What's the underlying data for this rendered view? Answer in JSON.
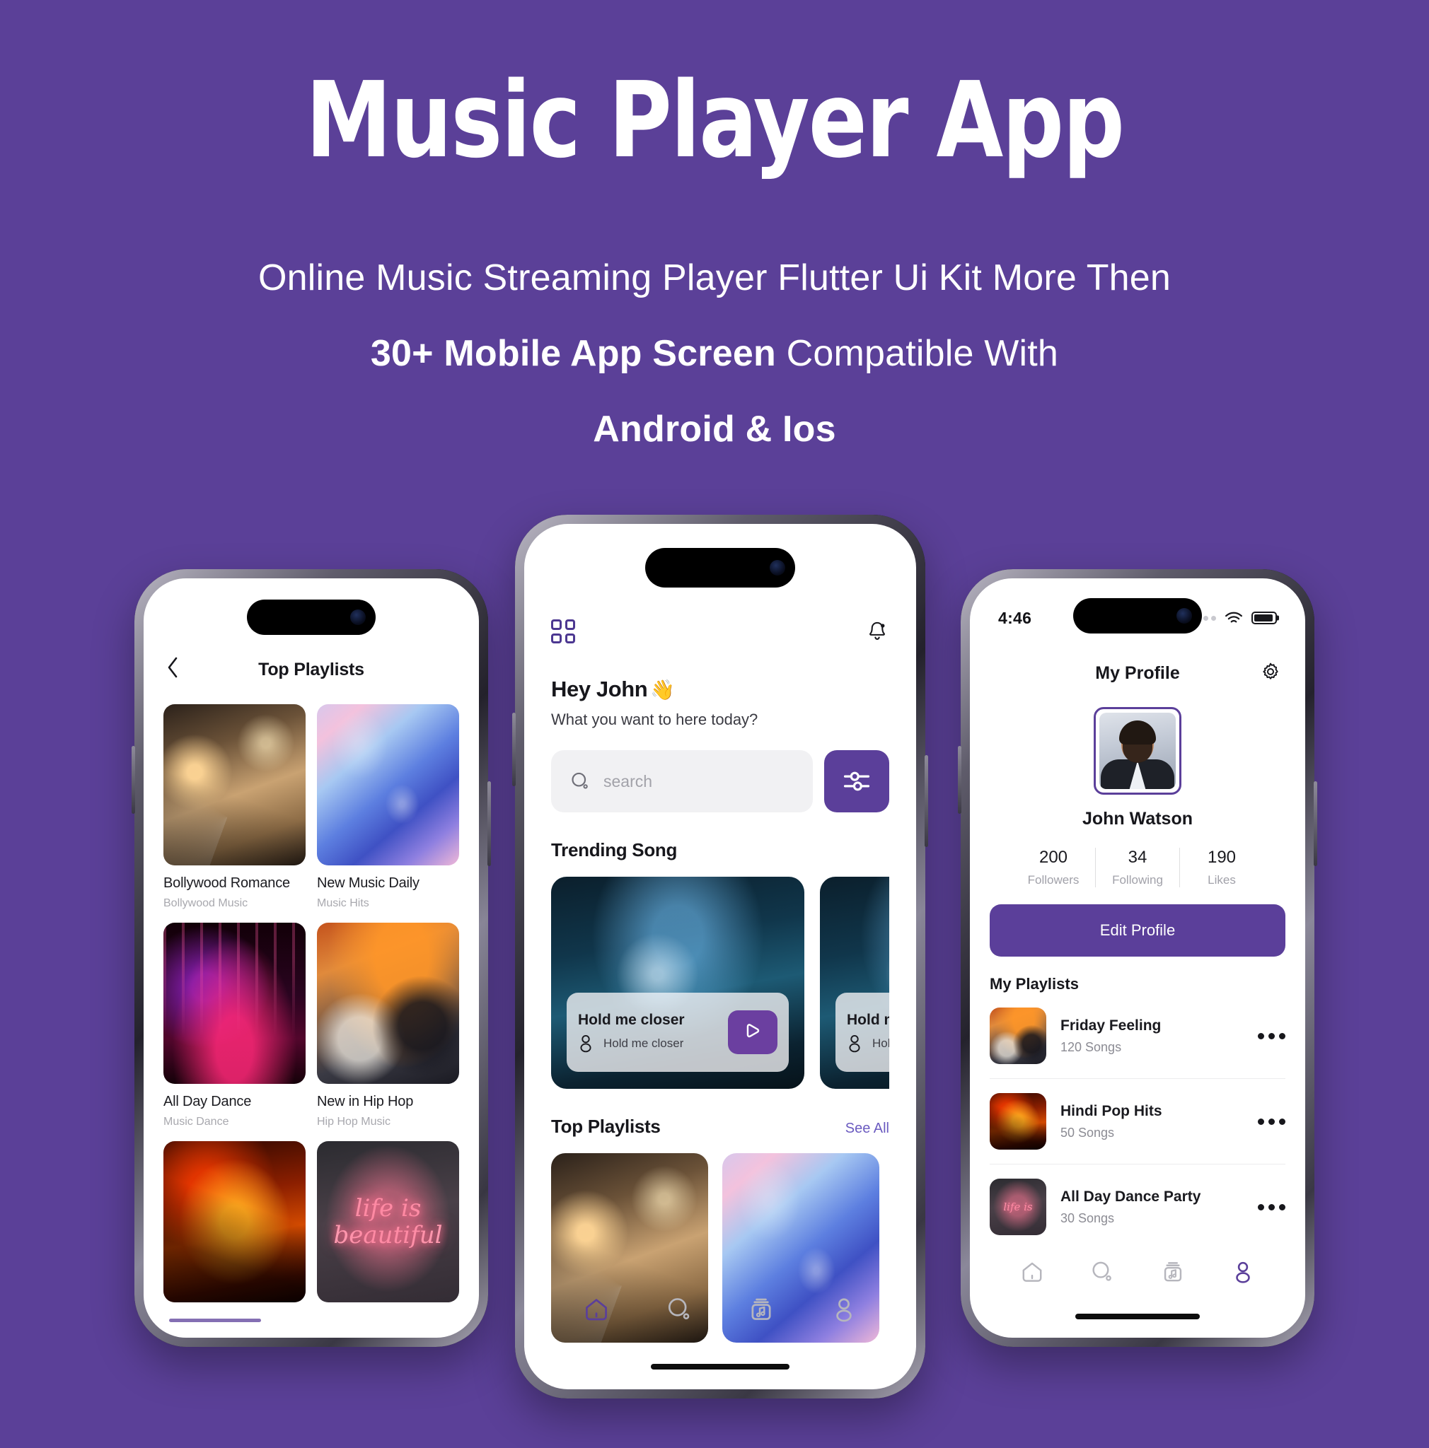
{
  "theme": {
    "brand": "#5b4098",
    "accent": "#5b3f9a",
    "link": "#6b5bc0"
  },
  "hero": {
    "title": "Music Player App",
    "line1": "Online Music Streaming Player Flutter Ui Kit More Then",
    "line2_bold": "30+ Mobile App Screen",
    "line2_rest": " Compatible With",
    "line3": "Android & Ios"
  },
  "phone_left": {
    "back_icon": "chevron-left-icon",
    "title": "Top Playlists",
    "playlists": [
      {
        "name": "Bollywood Romance",
        "sub": "Bollywood Music",
        "art": "art-romance"
      },
      {
        "name": "New Music Daily",
        "sub": "Music Hits",
        "art": "art-marble"
      },
      {
        "name": "All Day Dance",
        "sub": "Music Dance",
        "art": "art-dance"
      },
      {
        "name": "New in Hip Hop",
        "sub": "Hip Hop Music",
        "art": "art-hiphop"
      },
      {
        "name": "",
        "sub": "",
        "art": "art-guitar"
      },
      {
        "name": "",
        "sub": "",
        "art": "art-neon"
      }
    ],
    "neon_line1": "life is",
    "neon_line2": "beautiful"
  },
  "phone_mid": {
    "grid_icon": "grid-menu-icon",
    "bell_icon": "notification-bell-icon",
    "greeting": "Hey John",
    "greeting_emoji": "👋",
    "subtitle": "What you want to here today?",
    "search": {
      "placeholder": "search",
      "value": "",
      "icon": "search-icon"
    },
    "filter_icon": "filter-sliders-icon",
    "trending": {
      "title": "Trending Song",
      "cards": [
        {
          "title": "Hold me closer",
          "artist": "Hold me closer",
          "play_icon": "play-icon"
        },
        {
          "title": "Hold me closer",
          "artist": "Hold me closer",
          "play_icon": "play-icon"
        }
      ]
    },
    "top_playlists": {
      "title": "Top Playlists",
      "see_all": "See All",
      "items": [
        {
          "art": "art-romance"
        },
        {
          "art": "art-marble"
        },
        {
          "art": "art-romance"
        }
      ]
    },
    "nav": [
      {
        "name": "home",
        "icon": "home-icon",
        "active": true
      },
      {
        "name": "search",
        "icon": "search-icon",
        "active": false
      },
      {
        "name": "library",
        "icon": "music-library-icon",
        "active": false
      },
      {
        "name": "profile",
        "icon": "person-icon",
        "active": false
      }
    ]
  },
  "phone_right": {
    "status": {
      "time": "4:46",
      "wifi_icon": "wifi-icon",
      "battery_icon": "battery-icon"
    },
    "title": "My Profile",
    "settings_icon": "gear-icon",
    "avatar_icon": "avatar",
    "name": "John Watson",
    "stats": [
      {
        "value": "200",
        "label": "Followers"
      },
      {
        "value": "34",
        "label": "Following"
      },
      {
        "value": "190",
        "label": "Likes"
      }
    ],
    "edit_button": "Edit Profile",
    "playlists_title": "My Playlists",
    "playlists": [
      {
        "title": "Friday Feeling",
        "songs": "120 Songs",
        "art": "art-hiphop",
        "menu_icon": "more-options-icon"
      },
      {
        "title": "Hindi Pop Hits",
        "songs": "50 Songs",
        "art": "art-guitar",
        "menu_icon": "more-options-icon"
      },
      {
        "title": "All Day Dance Party",
        "songs": "30 Songs",
        "art": "art-neon",
        "menu_icon": "more-options-icon"
      }
    ],
    "neon_line1": "life is",
    "neon_line2": "beautiful",
    "nav": [
      {
        "name": "home",
        "icon": "home-icon",
        "active": false
      },
      {
        "name": "search",
        "icon": "search-icon",
        "active": false
      },
      {
        "name": "library",
        "icon": "music-library-icon",
        "active": false
      },
      {
        "name": "profile",
        "icon": "person-icon",
        "active": true
      }
    ]
  }
}
